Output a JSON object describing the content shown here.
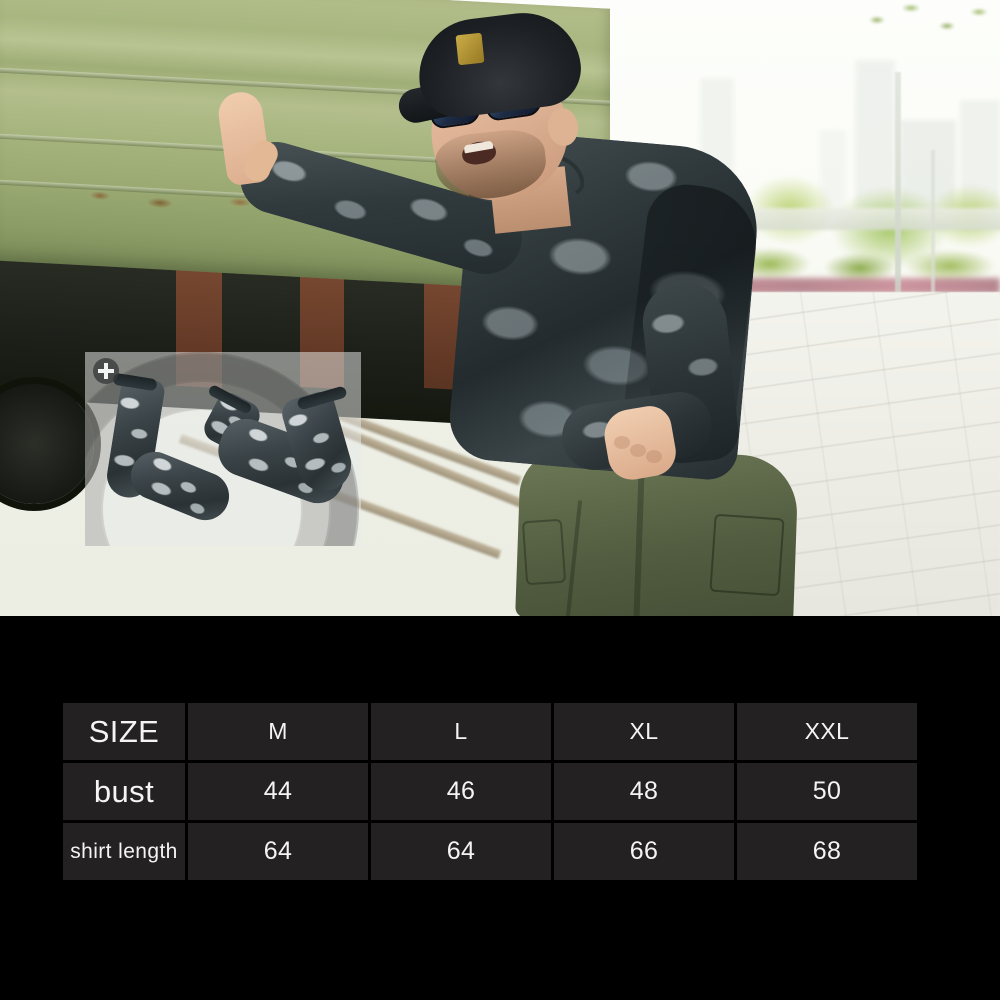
{
  "page": {
    "background_color": "#000000",
    "accent_panel_color": "#232121",
    "text_color": "#f4f4f4"
  },
  "photo": {
    "alt": "Man in dark camouflage long-sleeve tactical shirt leaning against a green rusted train car beside railway tracks",
    "subject_description": "Male model wearing black cap with gold emblem, blue-lens sunglasses, dark grey camouflage long-sleeve compression shirt and olive green tactical cargo pants",
    "background_description": "Green freight train car with rust stains, white gravel ballast, railway ties, blurred city skyline with trees and paved plaza"
  },
  "inset": {
    "name": "product-detail-overlay",
    "alt": "Pair of camouflage arm sleeves / compression sleeves shown on semi-transparent panel",
    "badge_icon": "plus-icon"
  },
  "size_chart": {
    "type": "table",
    "row_labels": [
      "SIZE",
      "bust",
      "shirt length"
    ],
    "columns": [
      "M",
      "L",
      "XL",
      "XXL"
    ],
    "rows": [
      {
        "label": "SIZE",
        "values": [
          "M",
          "L",
          "XL",
          "XXL"
        ]
      },
      {
        "label": "bust",
        "values": [
          "44",
          "46",
          "48",
          "50"
        ]
      },
      {
        "label": "shirt length",
        "values": [
          "64",
          "64",
          "66",
          "68"
        ]
      }
    ]
  }
}
